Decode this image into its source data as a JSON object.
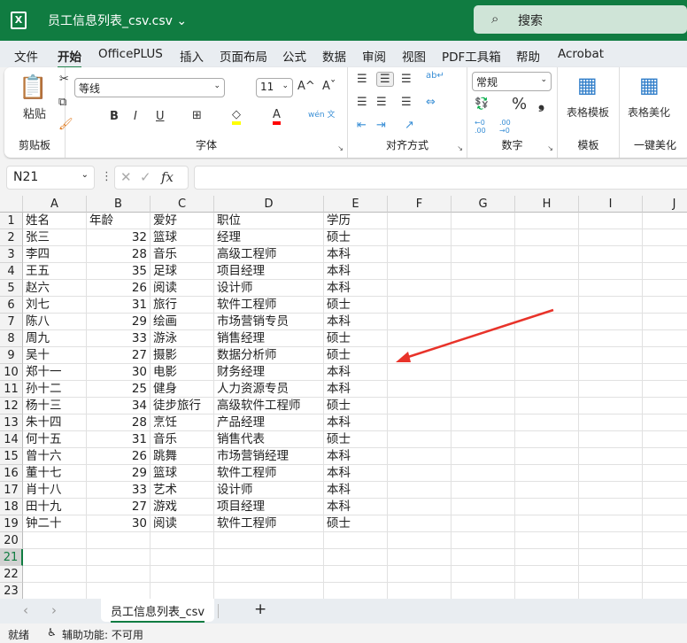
{
  "title_bar": {
    "app_icon": "excel-icon",
    "doc_title": "员工信息列表_csv.csv ⌄",
    "search_placeholder": "搜索",
    "search_icon": "search-icon"
  },
  "menu": [
    "文件",
    "开始",
    "OfficePLUS",
    "插入",
    "页面布局",
    "公式",
    "数据",
    "审阅",
    "视图",
    "PDF工具箱",
    "帮助",
    "Acrobat"
  ],
  "ribbon": {
    "clipboard": {
      "label": "剪贴板",
      "paste": "粘贴"
    },
    "font": {
      "label": "字体",
      "font_name": "等线",
      "font_size": "11",
      "bold": "B",
      "italic": "I",
      "underline": "U",
      "grow": "A^",
      "shrink": "Aˇ",
      "phonetic": "wén 文",
      "font_color_bar": "#ff0000",
      "fill_color_bar": "#ffff00"
    },
    "alignment": {
      "label": "对齐方式"
    },
    "number": {
      "label": "数字",
      "format": "常规",
      "percent": "%",
      "comma": "❟",
      "inc_decimal": "←0 .00",
      "dec_decimal": ".00 →0"
    },
    "template": {
      "label": "模板",
      "button": "表格模板"
    },
    "beautify": {
      "label": "一键美化",
      "button": "表格美化"
    }
  },
  "formula_bar": {
    "name_box": "N21",
    "fx": "fx",
    "value": ""
  },
  "columns": [
    "A",
    "B",
    "C",
    "D",
    "E",
    "F",
    "G",
    "H",
    "I",
    "J"
  ],
  "rows": [
    [
      "姓名",
      "年龄",
      "爱好",
      "职位",
      "学历"
    ],
    [
      "张三",
      "32",
      "篮球",
      "经理",
      "硕士"
    ],
    [
      "李四",
      "28",
      "音乐",
      "高级工程师",
      "本科"
    ],
    [
      "王五",
      "35",
      "足球",
      "项目经理",
      "本科"
    ],
    [
      "赵六",
      "26",
      "阅读",
      "设计师",
      "本科"
    ],
    [
      "刘七",
      "31",
      "旅行",
      "软件工程师",
      "硕士"
    ],
    [
      "陈八",
      "29",
      "绘画",
      "市场营销专员",
      "本科"
    ],
    [
      "周九",
      "33",
      "游泳",
      "销售经理",
      "硕士"
    ],
    [
      "吴十",
      "27",
      "摄影",
      "数据分析师",
      "硕士"
    ],
    [
      "郑十一",
      "30",
      "电影",
      "财务经理",
      "本科"
    ],
    [
      "孙十二",
      "25",
      "健身",
      "人力资源专员",
      "本科"
    ],
    [
      "杨十三",
      "34",
      "徒步旅行",
      "高级软件工程师",
      "硕士"
    ],
    [
      "朱十四",
      "28",
      "烹饪",
      "产品经理",
      "本科"
    ],
    [
      "何十五",
      "31",
      "音乐",
      "销售代表",
      "硕士"
    ],
    [
      "曾十六",
      "26",
      "跳舞",
      "市场营销经理",
      "本科"
    ],
    [
      "董十七",
      "29",
      "篮球",
      "软件工程师",
      "本科"
    ],
    [
      "肖十八",
      "33",
      "艺术",
      "设计师",
      "本科"
    ],
    [
      "田十九",
      "27",
      "游戏",
      "项目经理",
      "本科"
    ],
    [
      "钟二十",
      "30",
      "阅读",
      "软件工程师",
      "硕士"
    ]
  ],
  "row_count": 23,
  "selected_row": 21,
  "sheet_tabs": {
    "active": "员工信息列表_csv",
    "prev": "‹",
    "next": "›",
    "add": "+"
  },
  "status": {
    "ready": "就绪",
    "accessibility": "辅助功能: 不可用"
  },
  "annotation": {
    "arrow_color": "#e8332a"
  }
}
